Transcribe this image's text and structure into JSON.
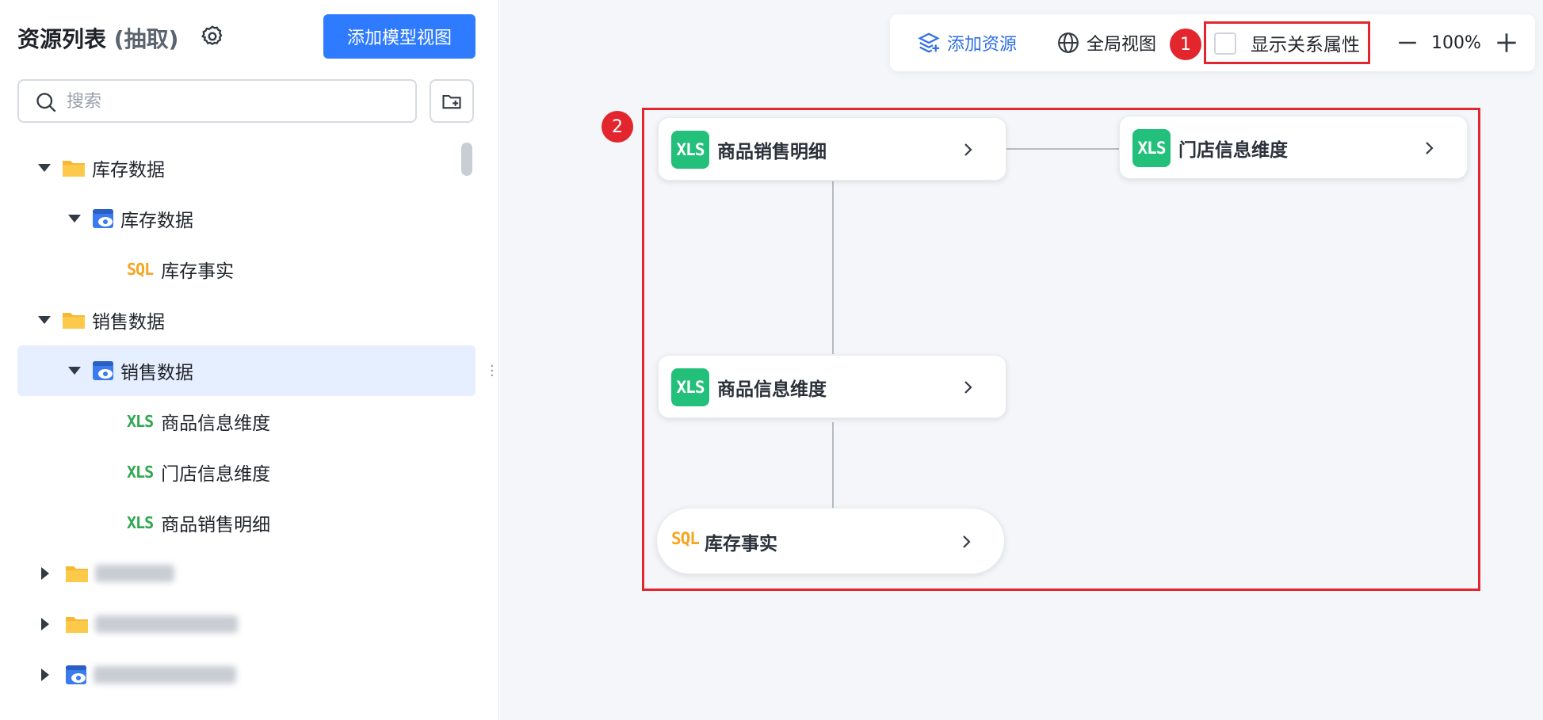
{
  "sidebar": {
    "title": "资源列表",
    "title_sub": "(抽取)",
    "add_button": "添加模型视图",
    "search_placeholder": "搜索",
    "tree": [
      {
        "level": 0,
        "type": "folder",
        "expanded": true,
        "label": "库存数据"
      },
      {
        "level": 1,
        "type": "view",
        "expanded": true,
        "label": "库存数据"
      },
      {
        "level": 2,
        "type": "sql",
        "tag": "SQL",
        "label": "库存事实"
      },
      {
        "level": 0,
        "type": "folder",
        "expanded": true,
        "label": "销售数据"
      },
      {
        "level": 1,
        "type": "view",
        "expanded": true,
        "selected": true,
        "label": "销售数据"
      },
      {
        "level": 2,
        "type": "xls",
        "tag": "XLS",
        "label": "商品信息维度"
      },
      {
        "level": 2,
        "type": "xls",
        "tag": "XLS",
        "label": "门店信息维度"
      },
      {
        "level": 2,
        "type": "xls",
        "tag": "XLS",
        "label": "商品销售明细"
      },
      {
        "level": 0,
        "type": "folder",
        "expanded": false,
        "label": "",
        "blurred": true
      },
      {
        "level": 0,
        "type": "folder",
        "expanded": false,
        "label": "",
        "blurred": true
      },
      {
        "level": 0,
        "type": "view",
        "expanded": false,
        "label": "",
        "blurred": true
      }
    ]
  },
  "toolbar": {
    "add_resource": "添加资源",
    "global_view": "全局视图",
    "show_relation_attrs": "显示关系属性",
    "show_relation_attrs_checked": false,
    "zoom": "100%"
  },
  "badges": {
    "one": "1",
    "two": "2"
  },
  "canvas": {
    "nodes": [
      {
        "id": "sales_detail",
        "type": "xls",
        "tag": "XLS",
        "label": "商品销售明细"
      },
      {
        "id": "store_dim",
        "type": "xls",
        "tag": "XLS",
        "label": "门店信息维度"
      },
      {
        "id": "product_dim",
        "type": "xls",
        "tag": "XLS",
        "label": "商品信息维度"
      },
      {
        "id": "inventory_fact",
        "type": "sql",
        "tag": "SQL",
        "label": "库存事实"
      }
    ]
  },
  "colors": {
    "primary": "#2f7bff",
    "selected_row": "#e6efff",
    "xls_green": "#22c07a",
    "sql_orange": "#f5a623",
    "highlight_red": "#e3262e"
  }
}
